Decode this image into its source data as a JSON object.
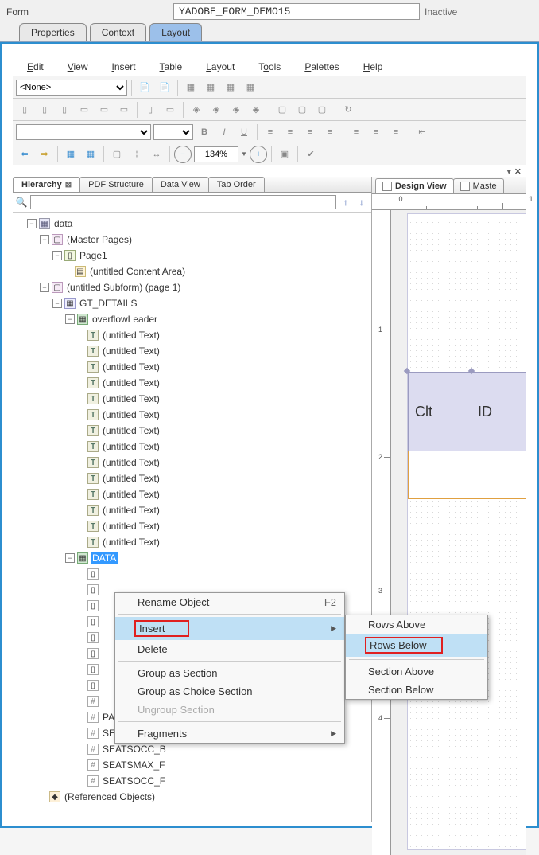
{
  "topbar": {
    "form_label": "Form",
    "form_name": "YADOBE_FORM_DEMO15",
    "status": "Inactive"
  },
  "main_tabs": {
    "properties": "Properties",
    "context": "Context",
    "layout": "Layout"
  },
  "menu": {
    "edit": "Edit",
    "view": "View",
    "insert": "Insert",
    "table": "Table",
    "layout": "Layout",
    "tools": "Tools",
    "palettes": "Palettes",
    "help": "Help"
  },
  "toolbar": {
    "none_option": "<None>",
    "zoom": "134%"
  },
  "panel_tabs": {
    "hierarchy": "Hierarchy",
    "pdf_structure": "PDF Structure",
    "data_view": "Data View",
    "tab_order": "Tab Order"
  },
  "tree": {
    "root": "data",
    "master_pages": "(Master Pages)",
    "page1": "Page1",
    "content_area": "(untitled Content Area)",
    "subform": "(untitled Subform) (page 1)",
    "gt_details": "GT_DETAILS",
    "overflow_leader": "overflowLeader",
    "untitled_text": "(untitled Text)",
    "data_node": "DATA",
    "paymentsum": "PAYMENTSUM",
    "seatsmax_b": "SEATSMAX_B",
    "seatsocc_b": "SEATSOCC_B",
    "seatsmax_f": "SEATSMAX_F",
    "seatsocc_f": "SEATSOCC_F",
    "referenced": "(Referenced Objects)"
  },
  "context_menu": {
    "rename": "Rename Object",
    "rename_shortcut": "F2",
    "insert": "Insert",
    "delete": "Delete",
    "group_section": "Group as Section",
    "group_choice": "Group as Choice Section",
    "ungroup": "Ungroup Section",
    "fragments": "Fragments"
  },
  "submenu": {
    "rows_above": "Rows Above",
    "rows_below": "Rows Below",
    "section_above": "Section Above",
    "section_below": "Section Below"
  },
  "right_panel": {
    "design_view": "Design View",
    "master": "Maste"
  },
  "design_table": {
    "header1": "Clt",
    "header2": "ID"
  },
  "ruler_h": {
    "n0": "0",
    "n1": "1"
  },
  "ruler_v": {
    "n1": "1",
    "n2": "2",
    "n3": "3",
    "n4": "4"
  }
}
